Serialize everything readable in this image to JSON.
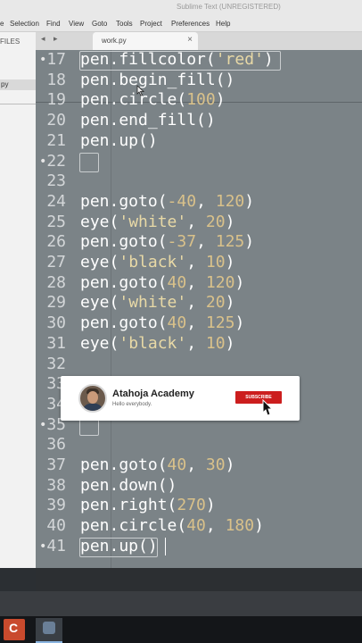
{
  "window": {
    "title": "Sublime Text (UNREGISTERED)"
  },
  "menu": [
    "e",
    "Selection",
    "Find",
    "View",
    "Goto",
    "Tools",
    "Project",
    "Preferences",
    "Help"
  ],
  "sidebar": {
    "header": "FILES",
    "file": "py"
  },
  "tabs": {
    "nav_left": "◂",
    "nav_right": "▸",
    "active": "work.py",
    "close": "×"
  },
  "lines": [
    {
      "n": "17",
      "code": [
        [
          "pen.fillcolor(",
          ""
        ],
        [
          "'red'",
          "str"
        ],
        [
          ")",
          ""
        ]
      ]
    },
    {
      "n": "18",
      "code": [
        [
          "pen.begin_fill()",
          ""
        ]
      ]
    },
    {
      "n": "19",
      "code": [
        [
          "pen.circle(",
          ""
        ],
        [
          "100",
          "num"
        ],
        [
          ")",
          ""
        ]
      ]
    },
    {
      "n": "20",
      "code": [
        [
          "pen.end_fill()",
          ""
        ]
      ]
    },
    {
      "n": "21",
      "code": [
        [
          "pen.up()",
          ""
        ]
      ]
    },
    {
      "n": "22",
      "code": []
    },
    {
      "n": "23",
      "code": []
    },
    {
      "n": "24",
      "code": [
        [
          "pen.goto(",
          ""
        ],
        [
          "-40",
          "num"
        ],
        [
          ", ",
          ""
        ],
        [
          "120",
          "num"
        ],
        [
          ")",
          ""
        ]
      ]
    },
    {
      "n": "25",
      "code": [
        [
          "eye(",
          ""
        ],
        [
          "'white'",
          "str"
        ],
        [
          ", ",
          ""
        ],
        [
          "20",
          "num"
        ],
        [
          ")",
          ""
        ]
      ]
    },
    {
      "n": "26",
      "code": [
        [
          "pen.goto(",
          ""
        ],
        [
          "-37",
          "num"
        ],
        [
          ", ",
          ""
        ],
        [
          "125",
          "num"
        ],
        [
          ")",
          ""
        ]
      ]
    },
    {
      "n": "27",
      "code": [
        [
          "eye(",
          ""
        ],
        [
          "'black'",
          "str"
        ],
        [
          ", ",
          ""
        ],
        [
          "10",
          "num"
        ],
        [
          ")",
          ""
        ]
      ]
    },
    {
      "n": "28",
      "code": [
        [
          "pen.goto(",
          ""
        ],
        [
          "40",
          "num"
        ],
        [
          ", ",
          ""
        ],
        [
          "120",
          "num"
        ],
        [
          ")",
          ""
        ]
      ]
    },
    {
      "n": "29",
      "code": [
        [
          "eye(",
          ""
        ],
        [
          "'white'",
          "str"
        ],
        [
          ", ",
          ""
        ],
        [
          "20",
          "num"
        ],
        [
          ")",
          ""
        ]
      ]
    },
    {
      "n": "30",
      "code": [
        [
          "pen.goto(",
          ""
        ],
        [
          "40",
          "num"
        ],
        [
          ", ",
          ""
        ],
        [
          "125",
          "num"
        ],
        [
          ")",
          ""
        ]
      ]
    },
    {
      "n": "31",
      "code": [
        [
          "eye(",
          ""
        ],
        [
          "'black'",
          "str"
        ],
        [
          ", ",
          ""
        ],
        [
          "10",
          "num"
        ],
        [
          ")",
          ""
        ]
      ]
    },
    {
      "n": "32",
      "code": []
    },
    {
      "n": "33",
      "code": []
    },
    {
      "n": "34",
      "code": []
    },
    {
      "n": "35",
      "code": []
    },
    {
      "n": "36",
      "code": []
    },
    {
      "n": "37",
      "code": [
        [
          "pen.goto(",
          ""
        ],
        [
          "40",
          "num"
        ],
        [
          ", ",
          ""
        ],
        [
          "30",
          "num"
        ],
        [
          ")",
          ""
        ]
      ]
    },
    {
      "n": "38",
      "code": [
        [
          "pen.down()",
          ""
        ]
      ]
    },
    {
      "n": "39",
      "code": [
        [
          "pen.right(",
          ""
        ],
        [
          "270",
          "num"
        ],
        [
          ")",
          ""
        ]
      ]
    },
    {
      "n": "40",
      "code": [
        [
          "pen.circle(",
          ""
        ],
        [
          "40",
          "num"
        ],
        [
          ", ",
          ""
        ],
        [
          "180",
          "num"
        ],
        [
          ")",
          ""
        ]
      ]
    },
    {
      "n": "41",
      "code": [
        [
          "pen.up()",
          ""
        ]
      ]
    }
  ],
  "fold_marks": [
    "17",
    "22",
    "35",
    "41"
  ],
  "banner": {
    "name": "Atahoja Academy",
    "tagline": "Hello everybody.",
    "button": "SUBSCRIBE"
  },
  "taskbar": {
    "app1": "C"
  },
  "colors": {
    "editor_bg": "#7b8387",
    "string": "#e8d9a6",
    "number": "#d9c18a",
    "subscribe": "#cc1e1e"
  }
}
